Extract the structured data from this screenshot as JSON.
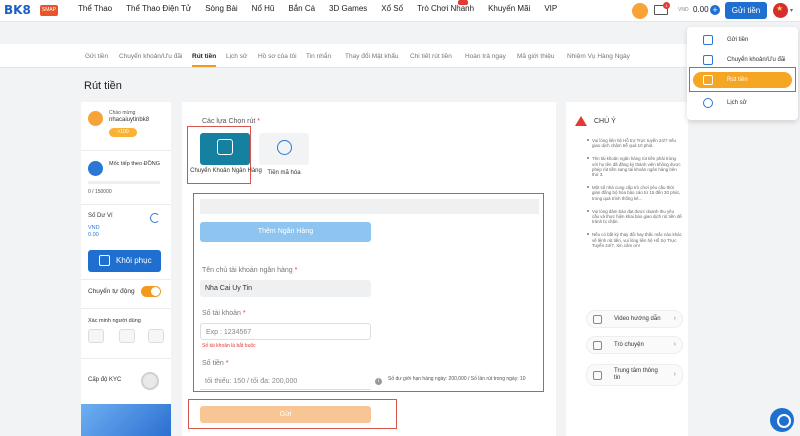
{
  "header": {
    "logo": "BK8",
    "logo_badge": "SMAP",
    "nav": [
      "Thể Thao",
      "Thể Thao Điện Tử",
      "Sòng Bài",
      "Nổ Hũ",
      "Bắn Cá",
      "3D Games",
      "Xổ Số",
      "Trò Chơi Nhanh",
      "Khuyến Mãi",
      "VIP"
    ],
    "mail_count": "1",
    "currency": "VND",
    "balance": "0.00",
    "deposit_label": "Gửi tiền"
  },
  "tabs": [
    "Gửi tiền",
    "Chuyển khoản/Ưu đãi",
    "Rút tiền",
    "Lịch sử",
    "Hồ sơ của tôi",
    "Tin nhắn",
    "Thay đổi Mật khẩu",
    "Chi tiết rút tiền",
    "Hoàn trả ngay",
    "Mã giới thiệu",
    "Nhiệm Vụ Hàng Ngày"
  ],
  "page_title": "Rút tiền",
  "profile": {
    "welcome": "Chào mừng",
    "username": "nhacaiuytinbk8",
    "vip": ">100",
    "level_label": "Mốc tiếp theo ĐỒNG",
    "progress": "0 / 150000",
    "wallet_label": "Số Dư Ví",
    "wallet_currency": "VND",
    "wallet_amount": "0.00",
    "restore_label": "Khôi phục",
    "auto_transfer": "Chuyển tự động",
    "verify_label": "Xác minh người dùng",
    "kyc_label": "Cấp độ KYC"
  },
  "withdraw": {
    "options_label": "Các lựa Chọn rút",
    "option_bank": "Chuyển Khoản Ngân Hàng",
    "option_crypto": "Tiền mã hóa",
    "add_bank": "Thêm Ngân Hàng",
    "holder_label": "Tên chủ tài khoản ngân hàng",
    "holder_value": "Nha Cai Uy Tin",
    "account_label": "Số tài khoản",
    "account_placeholder": "Exp : 1234567",
    "account_error": "Số tài khoản là bắt buộc",
    "amount_label": "Số tiền",
    "amount_placeholder": "tối thiểu: 150 / tối đa: 200,000",
    "limit_note": "Số dư giới hạn hàng ngày: 200,000 / Số lần rút trong ngày: 10",
    "submit": "Gửi",
    "req": "*"
  },
  "notes": {
    "title": "CHÚ Ý",
    "items": [
      "Vui lòng liên hệ Hỗ trợ Trực tuyến 24/7 nếu giao dịch chậm trễ quá 10 phút.",
      "Tên tài khoản ngân hàng rút tiền phải trùng với họ tên đã đăng ký thành viên không được phép rút tiền sang tài khoản ngân hàng bên thứ 3.",
      "Một số nhà cung cấp trò chơi yêu cầu thời gian đồng bộ hóa báo cáo từ 15 đến 30 phút, trong quá trình thống kê...",
      "Vui lòng đảm bảo đạt được doanh thu yêu cầu và thực hiện khai báo giao dịch rút tiền để tránh bị chặn.",
      "Nếu có bất kỳ thay đổi hay thắc mắc nào khác về lệnh rút tiền, vui lòng liên hệ Hỗ trợ Trực Tuyến 24/7. Xin cảm ơn!"
    ],
    "links": [
      "Video hướng dẫn",
      "Trò chuyện",
      "Trung tâm thông tin"
    ]
  },
  "dropdown": [
    "Gửi tiền",
    "Chuyển khoản/Ưu đãi",
    "Rút tiền",
    "Lịch sử"
  ]
}
